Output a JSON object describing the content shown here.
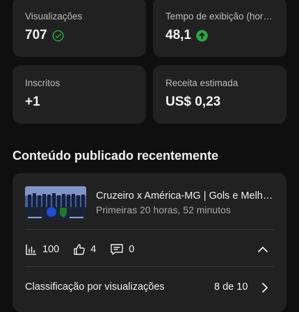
{
  "stats": [
    {
      "label": "Visualizações",
      "value": "707",
      "icon": "check-circle-icon"
    },
    {
      "label": "Tempo de exibição (horas)",
      "value": "48,1",
      "icon": "arrow-up-circle-icon"
    },
    {
      "label": "Inscritos",
      "value": "+1"
    },
    {
      "label": "Receita estimada",
      "value": "US$ 0,23"
    }
  ],
  "colors": {
    "accent_green": "#2ba640",
    "card_bg": "#212121",
    "page_bg": "#0f0f0f"
  },
  "recent": {
    "section_title": "Conteúdo publicado recentemente",
    "video": {
      "title": "Cruzeiro x América-MG | Gols e Melhores Momentos",
      "subtitle": "Primeiras 20 horas, 52 minutos",
      "views": "100",
      "likes": "4",
      "comments": "0"
    },
    "ranking": {
      "label": "Classificação por visualizações",
      "value": "8 de 10"
    }
  }
}
